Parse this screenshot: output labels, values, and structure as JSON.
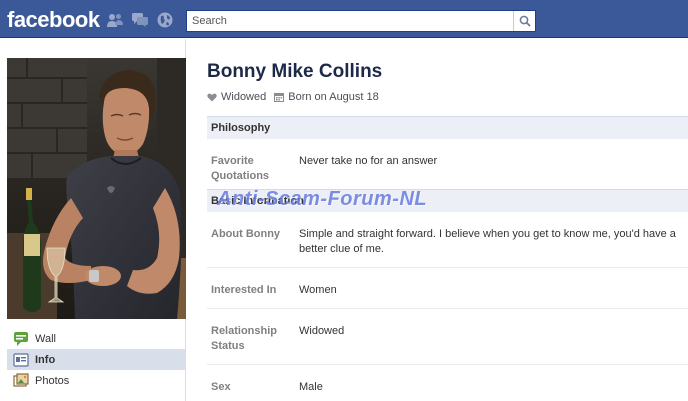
{
  "topbar": {
    "logo": "facebook",
    "search_placeholder": "Search"
  },
  "nav": {
    "items": [
      {
        "label": "Wall",
        "icon": "wall-icon"
      },
      {
        "label": "Info",
        "icon": "info-icon",
        "active": true
      },
      {
        "label": "Photos",
        "icon": "photos-icon"
      }
    ]
  },
  "profile": {
    "name": "Bonny Mike Collins",
    "status": "Widowed",
    "birthday": "Born on August 18"
  },
  "sections": {
    "philosophy": {
      "title": "Philosophy",
      "rows": [
        {
          "label": "Favorite Quotations",
          "value": "Never take no for an answer"
        }
      ]
    },
    "basic": {
      "title": "Basic Information",
      "rows": [
        {
          "label": "About Bonny",
          "value": "Simple and straight forward. I believe when you get to know me, you'd have a better clue of me."
        },
        {
          "label": "Interested In",
          "value": "Women"
        },
        {
          "label": "Relationship Status",
          "value": "Widowed"
        },
        {
          "label": "Sex",
          "value": "Male"
        }
      ]
    }
  },
  "watermark": "Anti-Scam-Forum-NL",
  "colors": {
    "brand": "#3b5998",
    "section_bg": "#eceff5",
    "name": "#1c2a47",
    "label": "#808080"
  }
}
